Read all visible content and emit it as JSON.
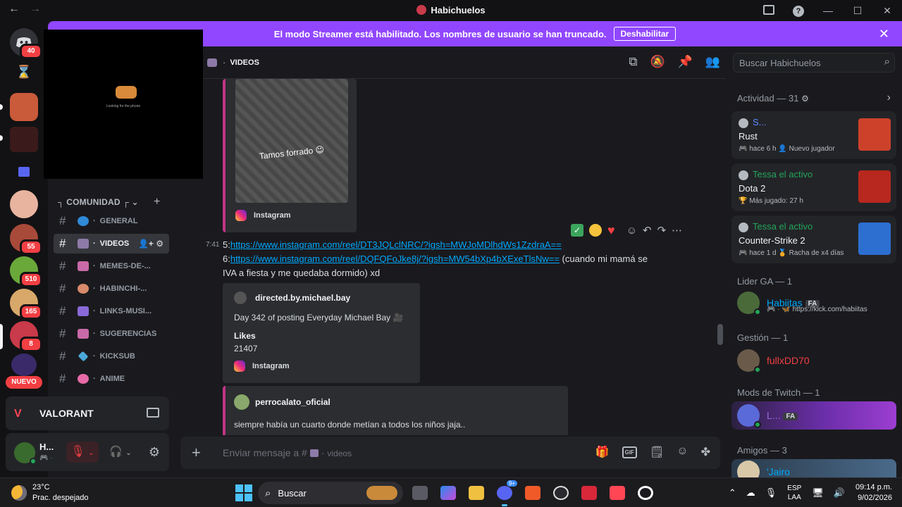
{
  "window": {
    "title": "Habichuelos"
  },
  "banner": {
    "text": "El modo Streamer está habilitado. Los nombres de usuario se han truncado.",
    "button": "Deshabilitar"
  },
  "rail": {
    "badges": [
      "40",
      "55",
      "510",
      "165",
      "8"
    ],
    "new_label": "NUEVO"
  },
  "overlay": {
    "caption": "Looking for the phone"
  },
  "sidebar": {
    "category": "┐ COMUNIDAD ┌",
    "channels": [
      {
        "name": "GENERAL",
        "emoji_color": "#2f8ad8"
      },
      {
        "name": "VIDEOS",
        "emoji_color": "#8e7aa8"
      },
      {
        "name": "MEMES-DE-...",
        "emoji_color": "#c96aa8"
      },
      {
        "name": "HABINCHI-...",
        "emoji_color": "#d88a6a"
      },
      {
        "name": "LINKS-MUSI...",
        "emoji_color": "#8a6ad8"
      },
      {
        "name": "SUGERENCIAS",
        "emoji_color": "#c96aa8"
      },
      {
        "name": "KICKSUB",
        "emoji_color": "#4aa8d8"
      },
      {
        "name": "ANIME",
        "emoji_color": "#e86aa8"
      }
    ]
  },
  "activity_bar": {
    "game": "VALORANT"
  },
  "user": {
    "name": "H...",
    "status": "🎮 ·"
  },
  "channel_header": {
    "name": "VIDEOS",
    "search_placeholder": "Buscar Habichuelos"
  },
  "messages": {
    "embed1": {
      "image_caption": "Tamos forrado 😉",
      "provider": "Instagram"
    },
    "time": "7:41",
    "line1_prefix": "5:",
    "line1_link": "https://www.instagram.com/reel/DT3JQLclNRC/?igsh=MWJoMDlhdWs1ZzdraA==",
    "line2_prefix": "6:",
    "line2_link": "https://www.instagram.com/reel/DQFQFoJke8j/?igsh=MW54bXp4bXExeTlsNw==",
    "line2_tail": " (cuando mi mamá se",
    "line3": "IVA a fiesta y me quedaba dormido) xd",
    "embed2": {
      "author": "directed.by.michael.bay",
      "description": "Day 342 of posting Everyday Michael Bay 🎥",
      "likes_label": "Likes",
      "likes_value": "21407",
      "provider": "Instagram"
    },
    "embed3": {
      "author": "perrocalato_oficial",
      "description": "siempre había un cuarto donde metían a todos los niños jaja.."
    }
  },
  "composer": {
    "placeholder_prefix": "Enviar mensaje a #",
    "placeholder_channel": "videos"
  },
  "members": {
    "activity_header": "Actividad — 31",
    "activities": [
      {
        "user": "S...",
        "user_color": "#5d8cff",
        "game": "Rust",
        "meta": "🎮 hace 6 h   👤 Nuevo jugador",
        "art_color": "#cd412b"
      },
      {
        "user": "Tessa el activo",
        "user_color": "#23a55a",
        "game": "Dota 2",
        "meta": "🏆 Más jugado: 27 h",
        "art_color": "#b8281e"
      },
      {
        "user": "Tessa el activo",
        "user_color": "#23a55a",
        "game": "Counter-Strike 2",
        "meta": "🎮 hace 1 d   🏅 Racha de x4 días",
        "art_color": "#2c6fd1"
      }
    ],
    "groups": [
      {
        "header": "Lider GA — 1",
        "name": "Habiitas",
        "name_color": "#00a8fc",
        "tag": "FA",
        "sub": "🎮 · 🦋 https://kick.com/habiitas"
      },
      {
        "header": "Gestión — 1",
        "name": "fullxDD70",
        "name_color": "#f23f43"
      },
      {
        "header": "Mods de Twitch — 1",
        "name": "L...",
        "name_color": "#9c6ad8",
        "tag": "FA"
      },
      {
        "header": "Amigos — 3",
        "name": "'Jairo",
        "name_color": "#00a8fc"
      }
    ]
  },
  "taskbar": {
    "temp": "23°C",
    "weather": "Prac. despejado",
    "search": "Buscar",
    "lang1": "ESP",
    "lang2": "LAA",
    "time": "09:14 p.m.",
    "date": "9/02/2026",
    "discord_badge": "9+"
  }
}
